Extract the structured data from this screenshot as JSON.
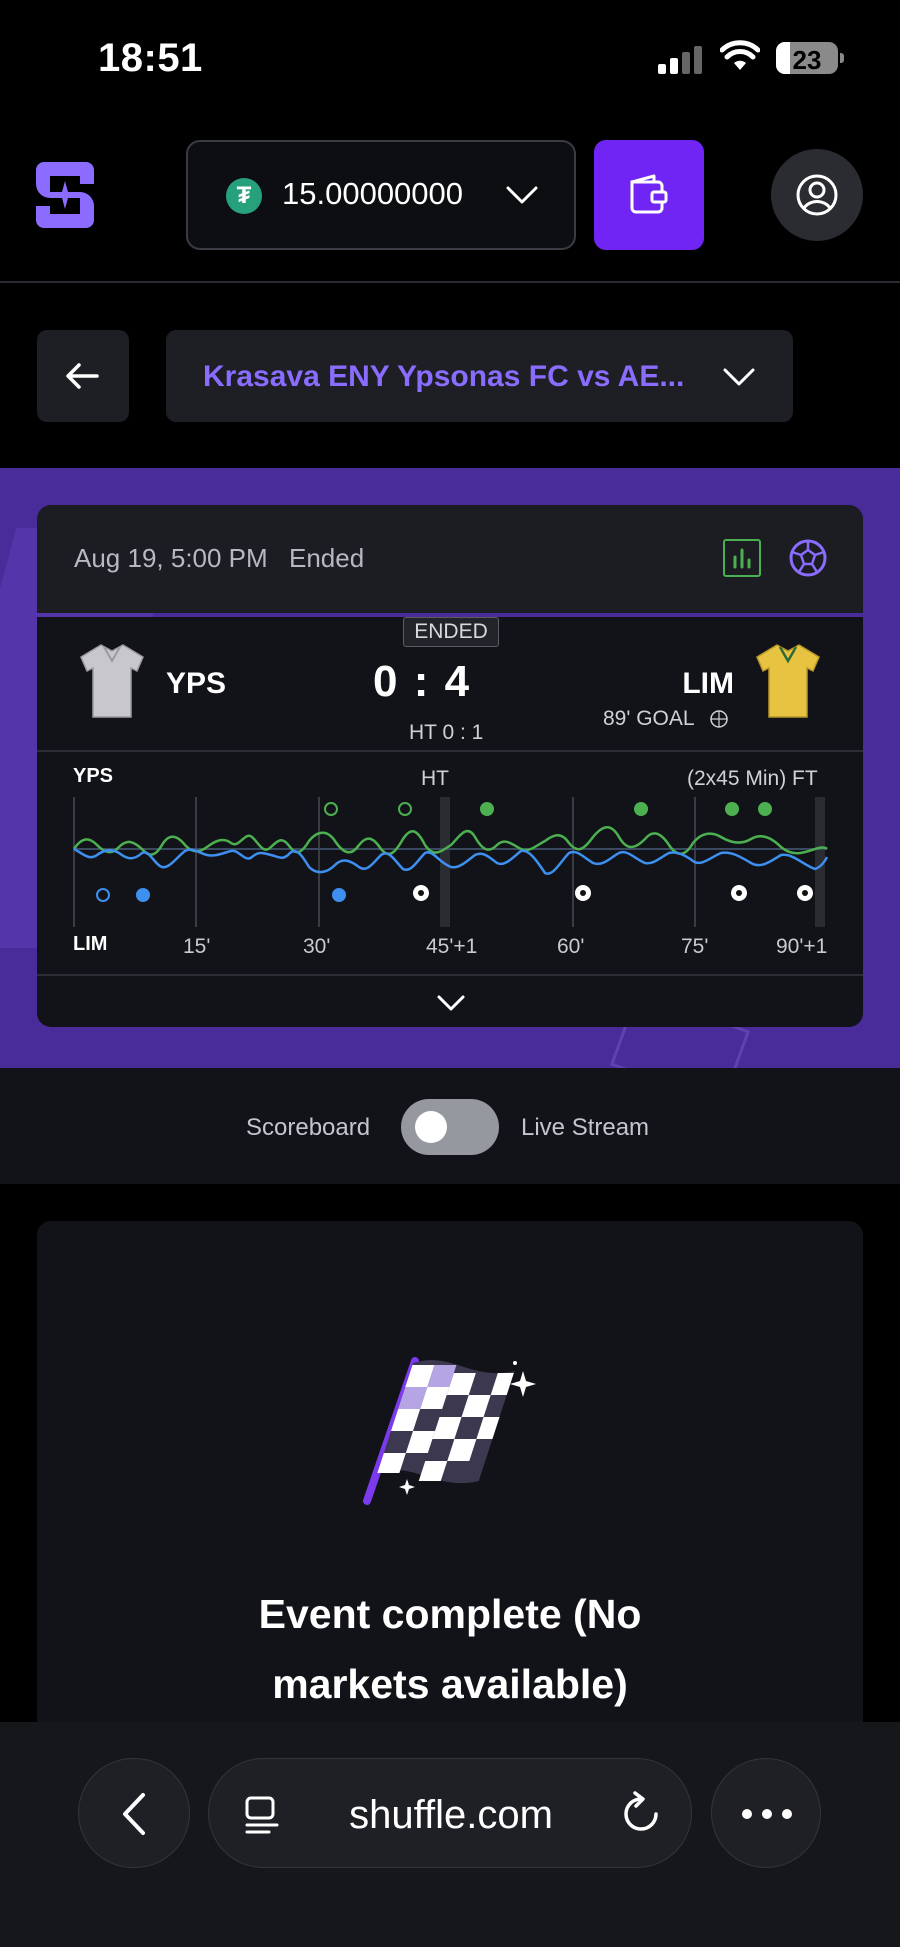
{
  "status_bar": {
    "time": "18:51",
    "battery": "23",
    "battery_fraction": 0.23
  },
  "header": {
    "balance_amount": "15.00000000",
    "currency_icon": "tether-icon",
    "currency_glyph": "₮",
    "wallet_icon": "wallet-icon",
    "profile_icon": "user-icon"
  },
  "event": {
    "title": "Krasava ENY Ypsonas FC vs AE..."
  },
  "match": {
    "date": "Aug 19, 5:00 PM",
    "status": "Ended",
    "badge": "ENDED",
    "home_team": "YPS",
    "away_team": "LIM",
    "score": "0 : 4",
    "ht_score": "HT 0 : 1",
    "last_event": "89'  GOAL",
    "timeline": {
      "home_label": "YPS",
      "away_label": "LIM",
      "ht_label": "HT",
      "ft_label": "(2x45 Min) FT",
      "ticks": [
        "15'",
        "30'",
        "45'+1",
        "60'",
        "75'",
        "90'+1"
      ]
    }
  },
  "toggle": {
    "left_label": "Scoreboard",
    "right_label": "Live Stream",
    "enabled": false
  },
  "content": {
    "title_line1": "Event complete (No",
    "title_line2": "markets available)"
  },
  "browser": {
    "url": "shuffle.com"
  },
  "colors": {
    "accent": "#7125f5",
    "accent_text": "#8a6cff",
    "hero_bg": "#4a2b9a",
    "home_line": "#4caf50",
    "away_line": "#3d8ff0"
  }
}
